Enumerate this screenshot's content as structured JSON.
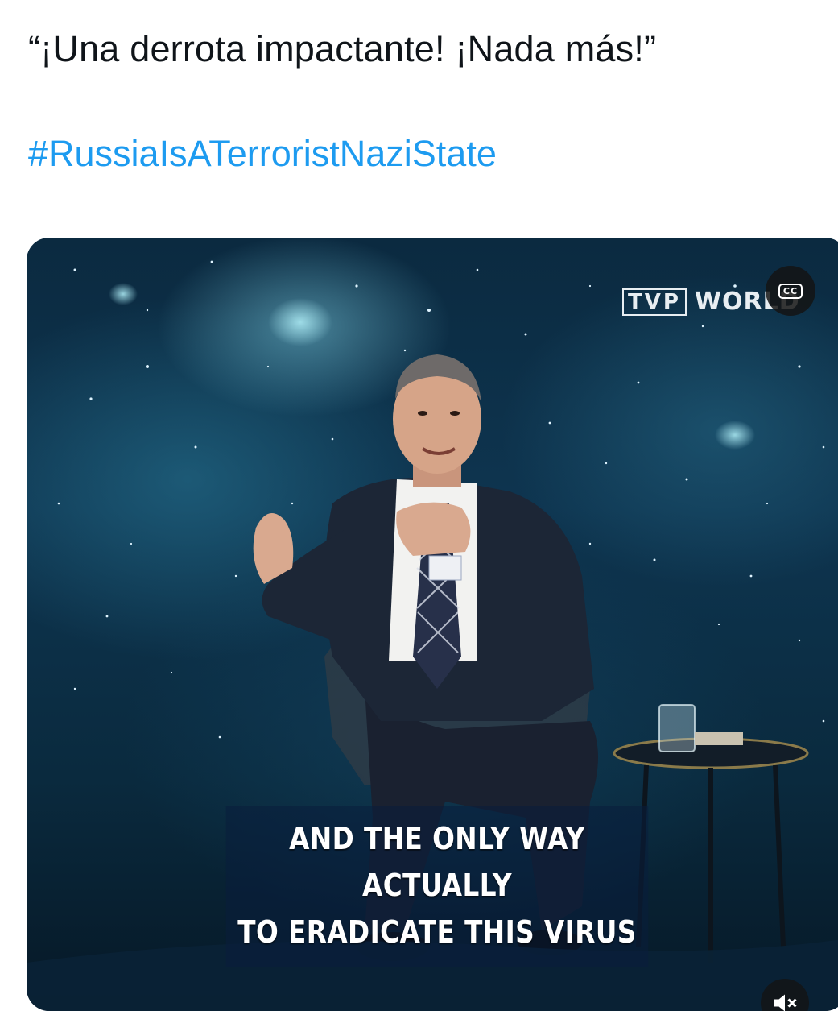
{
  "tweet": {
    "text": "“¡Una derrota impactante! ¡Nada más!”",
    "hashtag": "#RussiaIsATerroristNaziState"
  },
  "video": {
    "channel_logo_box": "TVP",
    "channel_logo_word": "WORLD",
    "cc_label": "CC",
    "caption_line1": "AND THE ONLY WAY ACTUALLY",
    "caption_line2": "TO ERADICATE THIS VIRUS",
    "volume_icon": "speaker-muted-icon",
    "colors": {
      "link": "#1d9bf0",
      "background_space": "#0e3550"
    }
  }
}
